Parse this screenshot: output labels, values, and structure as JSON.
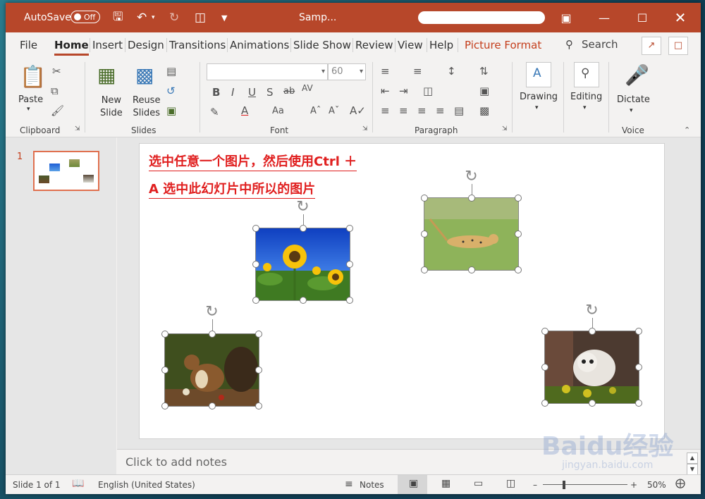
{
  "titlebar": {
    "autosave_label": "AutoSave",
    "autosave_state": "Off",
    "doc_title": "Samp...",
    "bg": "#b7472a"
  },
  "tabs": [
    "File",
    "Home",
    "Insert",
    "Design",
    "Transitions",
    "Animations",
    "Slide Show",
    "Review",
    "View",
    "Help",
    "Picture Format"
  ],
  "search_label": "Search",
  "ribbon": {
    "clipboard": {
      "paste": "Paste",
      "group": "Clipboard"
    },
    "slides": {
      "new_slide_1": "New",
      "new_slide_2": "Slide",
      "reuse_1": "Reuse",
      "reuse_2": "Slides",
      "group": "Slides"
    },
    "font": {
      "size": "60",
      "group": "Font"
    },
    "paragraph": {
      "group": "Paragraph"
    },
    "drawing": "Drawing",
    "editing": "Editing",
    "dictate": "Dictate",
    "voice_group": "Voice"
  },
  "thumb": {
    "number": "1"
  },
  "slide": {
    "line1": "选中任意一个图片，然后使用Ctrl ＋",
    "line2": "A 选中此幻灯片中所以的图片"
  },
  "notes_placeholder": "Click to add notes",
  "status": {
    "slide_of": "Slide 1 of 1",
    "language": "English (United States)",
    "notes": "Notes",
    "zoom": "50%"
  },
  "watermark": {
    "brand": "Baidu经验",
    "url": "jingyan.baidu.com"
  },
  "colors": {
    "accent": "#b7472a",
    "annotation_red": "#e01f1f"
  }
}
